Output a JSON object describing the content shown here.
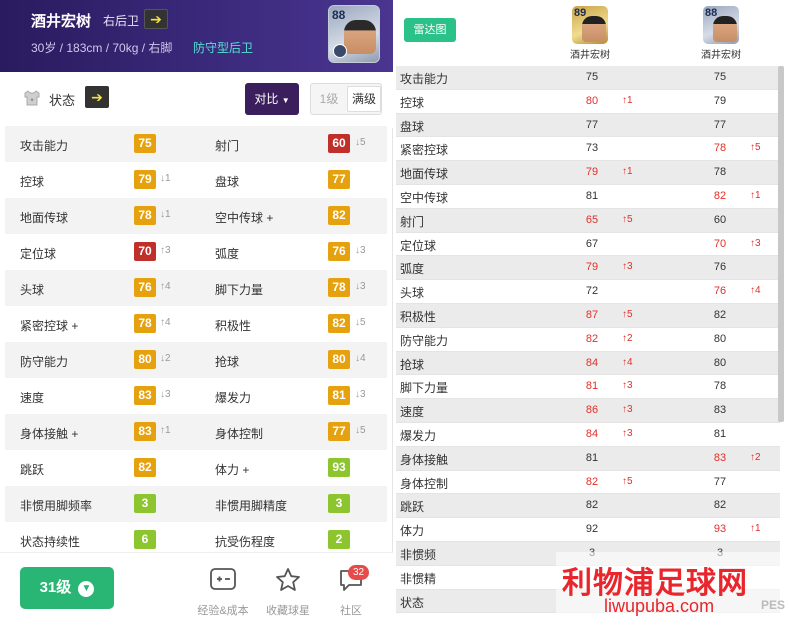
{
  "player": {
    "name": "酒井宏树",
    "position": "右后卫",
    "info": "30岁 / 183cm / 70kg / 右脚",
    "role": "防守型后卫",
    "rating": "88"
  },
  "toolbar": {
    "status_label": "状态",
    "compare_label": "对比",
    "level_1": "1级",
    "level_max": "满级"
  },
  "stats": [
    {
      "left": {
        "label": "攻击能力",
        "value": "75",
        "color": "orange",
        "delta": ""
      },
      "right": {
        "label": "射门",
        "value": "60",
        "color": "red",
        "delta": "↓5"
      }
    },
    {
      "left": {
        "label": "控球",
        "value": "79",
        "color": "orange",
        "delta": "↓1"
      },
      "right": {
        "label": "盘球",
        "value": "77",
        "color": "orange",
        "delta": ""
      }
    },
    {
      "left": {
        "label": "地面传球",
        "value": "78",
        "color": "orange",
        "delta": "↓1"
      },
      "right": {
        "label": "空中传球 +",
        "value": "82",
        "color": "orange",
        "delta": ""
      }
    },
    {
      "left": {
        "label": "定位球",
        "value": "70",
        "color": "red",
        "delta": "↑3"
      },
      "right": {
        "label": "弧度",
        "value": "76",
        "color": "orange",
        "delta": "↓3"
      }
    },
    {
      "left": {
        "label": "头球",
        "value": "76",
        "color": "orange",
        "delta": "↑4"
      },
      "right": {
        "label": "脚下力量",
        "value": "78",
        "color": "orange",
        "delta": "↓3"
      }
    },
    {
      "left": {
        "label": "紧密控球 +",
        "value": "78",
        "color": "orange",
        "delta": "↑4"
      },
      "right": {
        "label": "积极性",
        "value": "82",
        "color": "orange",
        "delta": "↓5"
      }
    },
    {
      "left": {
        "label": "防守能力",
        "value": "80",
        "color": "orange",
        "delta": "↓2"
      },
      "right": {
        "label": "抢球",
        "value": "80",
        "color": "orange",
        "delta": "↓4"
      }
    },
    {
      "left": {
        "label": "速度",
        "value": "83",
        "color": "orange",
        "delta": "↓3"
      },
      "right": {
        "label": "爆发力",
        "value": "81",
        "color": "orange",
        "delta": "↓3"
      }
    },
    {
      "left": {
        "label": "身体接触 +",
        "value": "83",
        "color": "orange",
        "delta": "↑1"
      },
      "right": {
        "label": "身体控制",
        "value": "77",
        "color": "orange",
        "delta": "↓5"
      }
    },
    {
      "left": {
        "label": "跳跃",
        "value": "82",
        "color": "orange",
        "delta": ""
      },
      "right": {
        "label": "体力 +",
        "value": "93",
        "color": "green",
        "delta": ""
      }
    },
    {
      "left": {
        "label": "非惯用脚频率",
        "value": "3",
        "color": "green",
        "delta": ""
      },
      "right": {
        "label": "非惯用脚精度",
        "value": "3",
        "color": "green",
        "delta": ""
      }
    },
    {
      "left": {
        "label": "状态持续性",
        "value": "6",
        "color": "green",
        "delta": ""
      },
      "right": {
        "label": "抗受伤程度",
        "value": "2",
        "color": "green",
        "delta": ""
      }
    }
  ],
  "footer": {
    "level_button": "31级",
    "exp_label": "经验&成本",
    "collect_label": "收藏球星",
    "community_label": "社区",
    "community_badge": "32"
  },
  "compare": {
    "radar_label": "雷达图",
    "players": [
      {
        "name": "酒井宏树",
        "rating": "89"
      },
      {
        "name": "酒井宏树",
        "rating": "88"
      }
    ],
    "rows": [
      {
        "label": "攻击能力",
        "a": "75",
        "a_red": false,
        "a_delta": "",
        "b": "75",
        "b_red": false,
        "b_delta": ""
      },
      {
        "label": "控球",
        "a": "80",
        "a_red": true,
        "a_delta": "↑1",
        "b": "79",
        "b_red": false,
        "b_delta": ""
      },
      {
        "label": "盘球",
        "a": "77",
        "a_red": false,
        "a_delta": "",
        "b": "77",
        "b_red": false,
        "b_delta": ""
      },
      {
        "label": "紧密控球",
        "a": "73",
        "a_red": false,
        "a_delta": "",
        "b": "78",
        "b_red": true,
        "b_delta": "↑5"
      },
      {
        "label": "地面传球",
        "a": "79",
        "a_red": true,
        "a_delta": "↑1",
        "b": "78",
        "b_red": false,
        "b_delta": ""
      },
      {
        "label": "空中传球",
        "a": "81",
        "a_red": false,
        "a_delta": "",
        "b": "82",
        "b_red": true,
        "b_delta": "↑1"
      },
      {
        "label": "射门",
        "a": "65",
        "a_red": true,
        "a_delta": "↑5",
        "b": "60",
        "b_red": false,
        "b_delta": ""
      },
      {
        "label": "定位球",
        "a": "67",
        "a_red": false,
        "a_delta": "",
        "b": "70",
        "b_red": true,
        "b_delta": "↑3"
      },
      {
        "label": "弧度",
        "a": "79",
        "a_red": true,
        "a_delta": "↑3",
        "b": "76",
        "b_red": false,
        "b_delta": ""
      },
      {
        "label": "头球",
        "a": "72",
        "a_red": false,
        "a_delta": "",
        "b": "76",
        "b_red": true,
        "b_delta": "↑4"
      },
      {
        "label": "积极性",
        "a": "87",
        "a_red": true,
        "a_delta": "↑5",
        "b": "82",
        "b_red": false,
        "b_delta": ""
      },
      {
        "label": "防守能力",
        "a": "82",
        "a_red": true,
        "a_delta": "↑2",
        "b": "80",
        "b_red": false,
        "b_delta": ""
      },
      {
        "label": "抢球",
        "a": "84",
        "a_red": true,
        "a_delta": "↑4",
        "b": "80",
        "b_red": false,
        "b_delta": ""
      },
      {
        "label": "脚下力量",
        "a": "81",
        "a_red": true,
        "a_delta": "↑3",
        "b": "78",
        "b_red": false,
        "b_delta": ""
      },
      {
        "label": "速度",
        "a": "86",
        "a_red": true,
        "a_delta": "↑3",
        "b": "83",
        "b_red": false,
        "b_delta": ""
      },
      {
        "label": "爆发力",
        "a": "84",
        "a_red": true,
        "a_delta": "↑3",
        "b": "81",
        "b_red": false,
        "b_delta": ""
      },
      {
        "label": "身体接触",
        "a": "81",
        "a_red": false,
        "a_delta": "",
        "b": "83",
        "b_red": true,
        "b_delta": "↑2"
      },
      {
        "label": "身体控制",
        "a": "82",
        "a_red": true,
        "a_delta": "↑5",
        "b": "77",
        "b_red": false,
        "b_delta": ""
      },
      {
        "label": "跳跃",
        "a": "82",
        "a_red": false,
        "a_delta": "",
        "b": "82",
        "b_red": false,
        "b_delta": ""
      },
      {
        "label": "体力",
        "a": "92",
        "a_red": false,
        "a_delta": "",
        "b": "93",
        "b_red": true,
        "b_delta": "↑1"
      },
      {
        "label": "非惯频",
        "a": "3",
        "a_red": false,
        "a_delta": "",
        "b": "3",
        "b_red": false,
        "b_delta": ""
      },
      {
        "label": "非惯精",
        "a": "",
        "a_red": false,
        "a_delta": "",
        "b": "",
        "b_red": false,
        "b_delta": ""
      },
      {
        "label": "状态",
        "a": "",
        "a_red": false,
        "a_delta": "",
        "b": "",
        "b_red": false,
        "b_delta": ""
      }
    ]
  },
  "watermark": {
    "cn": "利物浦足球网",
    "en": "liwupuba.com",
    "pes": "PES"
  }
}
